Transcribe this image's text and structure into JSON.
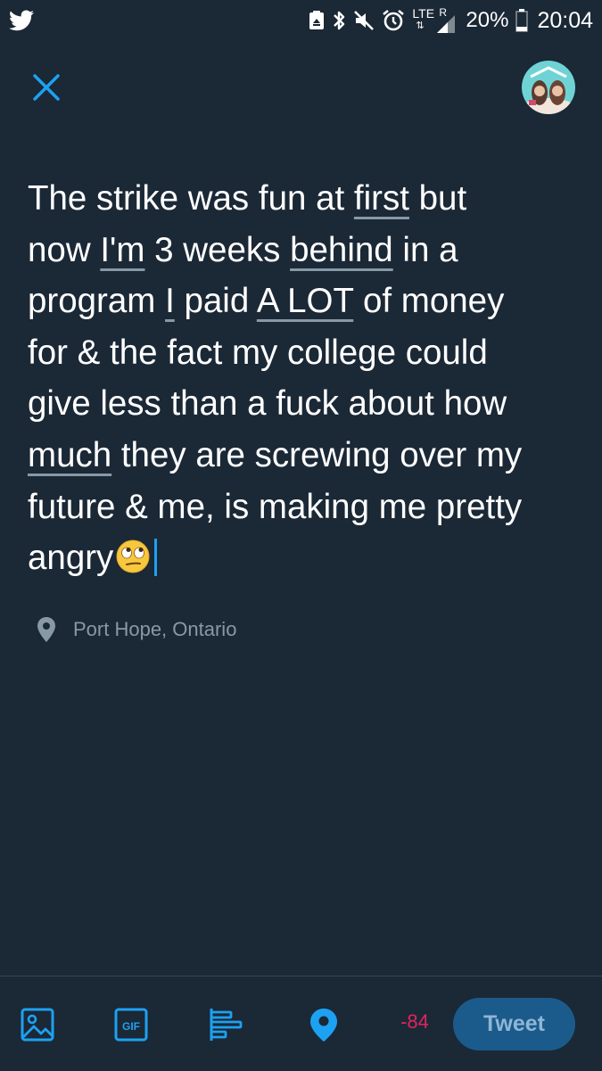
{
  "status_bar": {
    "network": "LTE",
    "roaming": "R",
    "battery": "20%",
    "time": "20:04",
    "icons": [
      "twitter-icon",
      "screenshot-icon",
      "bluetooth-icon",
      "mute-icon",
      "alarm-icon",
      "signal-icon",
      "battery-icon"
    ]
  },
  "compose": {
    "close_icon": "close-icon",
    "avatar": "user-avatar"
  },
  "tweet": {
    "seg1": "The strike was fun at ",
    "w_first": "first",
    "seg2": " but\nnow ",
    "w_im": "I'm",
    "seg3": " 3 weeks ",
    "w_behind": "behind",
    "seg4": " in a\nprogram ",
    "w_i": "I",
    "seg5": " paid ",
    "w_alot": "A LOT",
    "seg6": " of money\nfor & the fact my college could\ngive less than a fuck about how\n",
    "w_much": "much",
    "seg7": " they are screwing over my\nfuture & me, is making me pretty\nangry",
    "emoji": "rolling-eyes-emoji"
  },
  "location": {
    "icon": "location-pin-icon",
    "label": "Port Hope, Ontario"
  },
  "toolbar": {
    "icons": [
      "image-icon",
      "gif-icon",
      "poll-icon",
      "location-icon"
    ],
    "gif_label": "GIF",
    "counter": "-84",
    "tweet_label": "Tweet"
  },
  "colors": {
    "background": "#1b2836",
    "accent": "#1da1f2",
    "muted": "#8899a6",
    "counter": "#e0245e",
    "tweet_button": "#1a5b8c"
  }
}
